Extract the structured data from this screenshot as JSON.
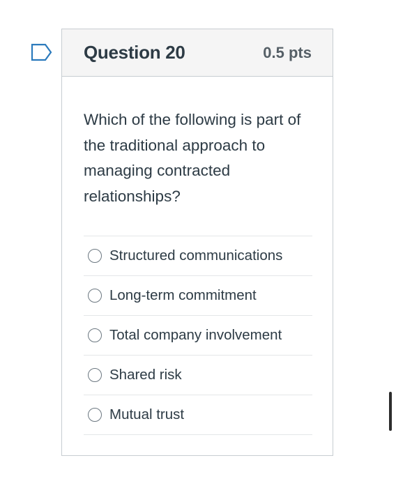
{
  "question": {
    "title": "Question 20",
    "points": "0.5 pts",
    "text": "Which of the following is part of the traditional approach to managing contracted relationships?",
    "flag_icon": "bookmark-flag-icon",
    "answers": [
      {
        "label": "Structured communications",
        "selected": false
      },
      {
        "label": "Long-term commitment",
        "selected": false
      },
      {
        "label": "Total company involvement",
        "selected": false
      },
      {
        "label": "Shared risk",
        "selected": false
      },
      {
        "label": "Mutual trust",
        "selected": false
      }
    ]
  },
  "colors": {
    "accent_flag": "#2b7abc",
    "text": "#2d3b45",
    "header_bg": "#f5f5f5",
    "border": "#c7cdd1"
  }
}
